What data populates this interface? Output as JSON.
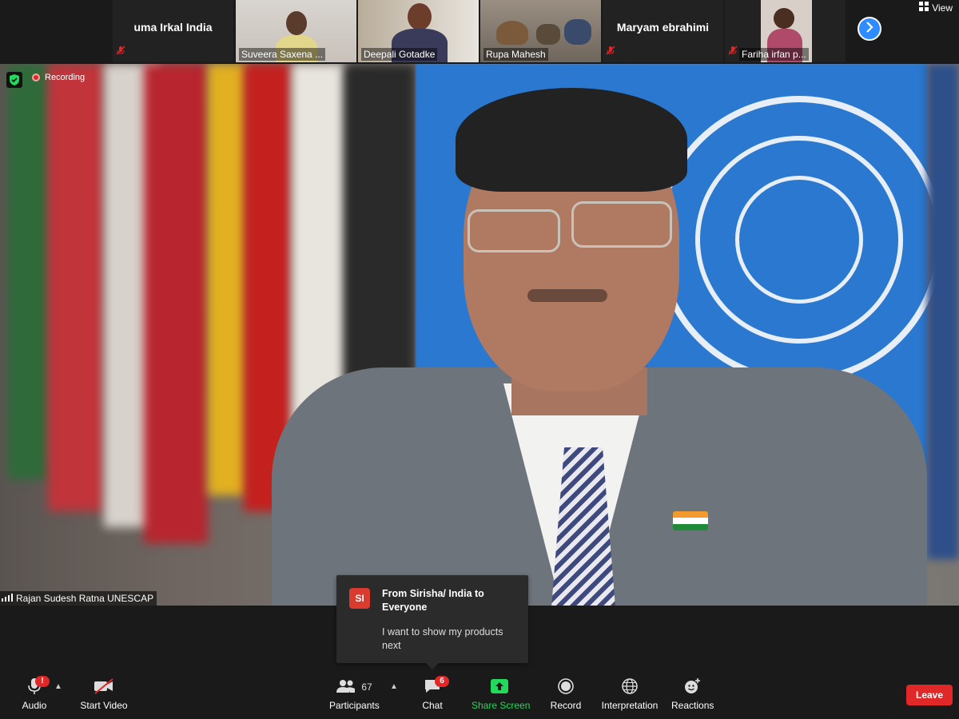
{
  "gallery": {
    "tiles": [
      {
        "name": "uma Irkal India",
        "muted": true,
        "video": false
      },
      {
        "name": "Suveera Saxena ...",
        "muted": false,
        "video": true
      },
      {
        "name": "Deepali Gotadke",
        "muted": false,
        "video": true
      },
      {
        "name": "Rupa Mahesh",
        "muted": false,
        "video": true
      },
      {
        "name": "Maryam ebrahimi",
        "muted": true,
        "video": false
      },
      {
        "name": "Fariha irfan p...",
        "muted": true,
        "video": true
      }
    ],
    "next_icon": "chevron-right-icon",
    "view_label": "View",
    "view_icon": "grid-icon"
  },
  "main_video": {
    "speaker_name": "Rajan Sudesh Ratna UNESCAP",
    "recording_label": "Recording",
    "security_icon": "shield-check-icon"
  },
  "chat_toast": {
    "avatar_initials": "SI",
    "from": "From Sirisha/ India to Everyone",
    "message": "I want to show my products next"
  },
  "toolbar": {
    "audio": {
      "label": "Audio",
      "icon": "microphone-icon",
      "badge": "!"
    },
    "video": {
      "label": "Start Video",
      "icon": "video-off-icon"
    },
    "participants": {
      "label": "Participants",
      "icon": "participants-icon",
      "count": "67"
    },
    "chat": {
      "label": "Chat",
      "icon": "chat-icon",
      "badge": "6"
    },
    "share": {
      "label": "Share Screen",
      "icon": "share-screen-icon",
      "color": "#23d959"
    },
    "record": {
      "label": "Record",
      "icon": "record-icon"
    },
    "interpretation": {
      "label": "Interpretation",
      "icon": "globe-icon"
    },
    "reactions": {
      "label": "Reactions",
      "icon": "smiley-add-icon"
    },
    "leave": {
      "label": "Leave",
      "color": "#e02828"
    }
  }
}
